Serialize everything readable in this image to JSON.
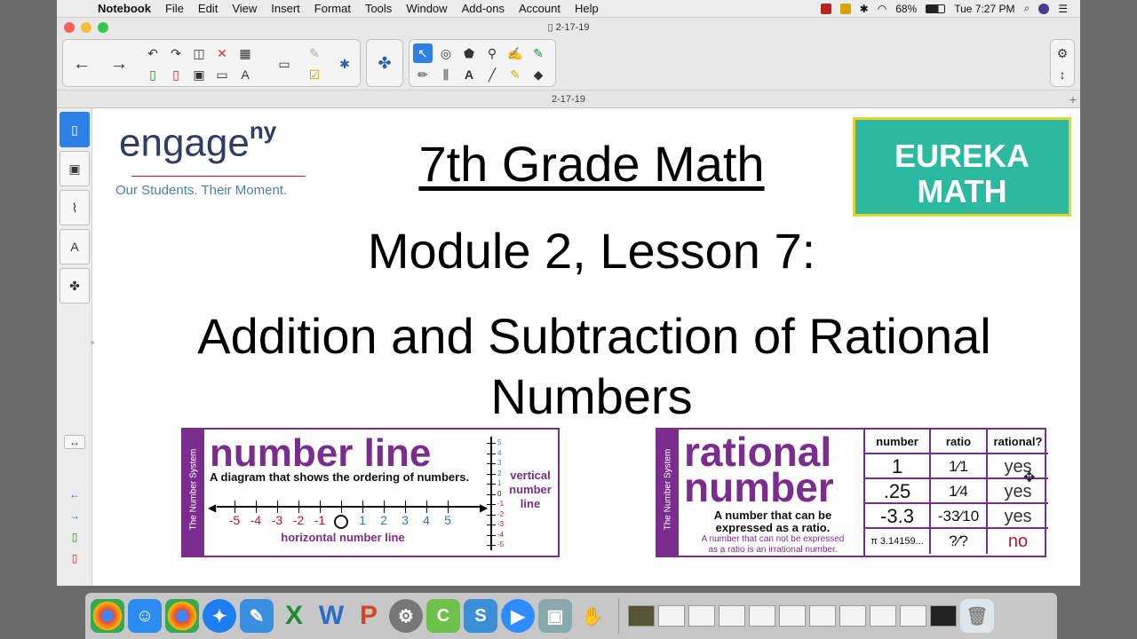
{
  "menubar": {
    "app_name": "Notebook",
    "items": [
      "File",
      "Edit",
      "View",
      "Insert",
      "Format",
      "Tools",
      "Window",
      "Add-ons",
      "Account",
      "Help"
    ],
    "battery": "68%",
    "clock": "Tue 7:27 PM"
  },
  "window": {
    "title": "2-17-19",
    "page_tab": "2-17-19"
  },
  "slide": {
    "engage_logo": "engage",
    "engage_logo_sup": "ny",
    "engage_tagline": "Our Students. Their Moment.",
    "title": "7th Grade Math",
    "subtitle": "Module 2, Lesson 7:",
    "topic_line1": "Addition and Subtraction of Rational",
    "topic_line2": "Numbers",
    "eureka_line1": "EUREKA",
    "eureka_line2": "MATH",
    "numberline_card": {
      "side_label": "The Number System",
      "heading": "number line",
      "definition": "A diagram that shows the ordering of numbers.",
      "ticks": [
        "-5",
        "-4",
        "-3",
        "-2",
        "-1",
        "0",
        "1",
        "2",
        "3",
        "4",
        "5"
      ],
      "horizontal_label": "horizontal number line",
      "vertical_label_1": "vertical",
      "vertical_label_2": "number",
      "vertical_label_3": "line",
      "vertical_ticks": [
        "5",
        "4",
        "3",
        "2",
        "1",
        "0",
        "-1",
        "-2",
        "-3",
        "-4",
        "-5"
      ]
    },
    "rational_card": {
      "side_label": "The Number System",
      "heading_1": "rational",
      "heading_2": "number",
      "def_1": "A number that can be",
      "def_2": "expressed as a ratio.",
      "def_3": "A number that can not be expressed",
      "def_4": "as a ratio is an irrational number.",
      "headers": [
        "number",
        "ratio",
        "rational?"
      ],
      "rows": [
        {
          "number": "1",
          "ratio": "1⁄1",
          "rational": "yes"
        },
        {
          "number": ".25",
          "ratio": "1⁄4",
          "rational": "yes"
        },
        {
          "number": "-3.3",
          "ratio": "-33⁄10",
          "rational": "yes"
        },
        {
          "number": "π 3.14159...",
          "ratio": "?⁄?",
          "rational": "no"
        }
      ]
    }
  },
  "colors": {
    "purple": "#7b2d8e",
    "eureka_teal": "#2bb9a0",
    "eureka_border": "#e6d42a",
    "red": "#c8102e",
    "blue": "#2a7fb8",
    "selected_blue": "#2f7fe8"
  }
}
